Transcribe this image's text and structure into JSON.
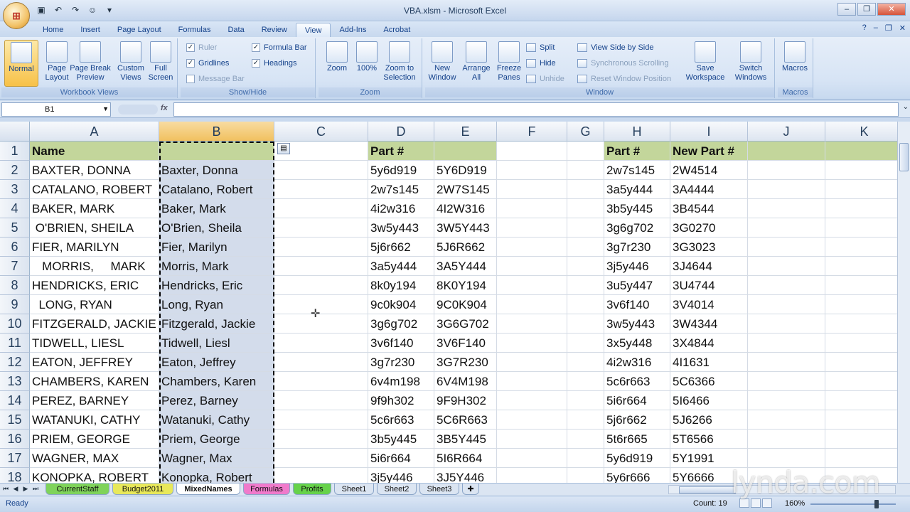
{
  "window": {
    "title": "VBA.xlsm - Microsoft Excel"
  },
  "office_button": {
    "icon": "office-logo-icon"
  },
  "ribbon_tabs": [
    "Home",
    "Insert",
    "Page Layout",
    "Formulas",
    "Data",
    "Review",
    "View",
    "Add-Ins",
    "Acrobat"
  ],
  "active_tab": "View",
  "ribbon": {
    "workbook_views": {
      "label": "Workbook Views",
      "normal": "Normal",
      "page_layout": "Page\nLayout",
      "page_break": "Page Break\nPreview",
      "custom_views": "Custom\nViews",
      "full_screen": "Full\nScreen"
    },
    "show_hide": {
      "label": "Show/Hide",
      "ruler": "Ruler",
      "gridlines": "Gridlines",
      "message_bar": "Message Bar",
      "formula_bar": "Formula Bar",
      "headings": "Headings"
    },
    "zoom": {
      "label": "Zoom",
      "zoom": "Zoom",
      "hundred": "100%",
      "zoom_selection": "Zoom to\nSelection"
    },
    "window": {
      "label": "Window",
      "new_window": "New\nWindow",
      "arrange_all": "Arrange\nAll",
      "freeze_panes": "Freeze\nPanes",
      "split": "Split",
      "hide": "Hide",
      "unhide": "Unhide",
      "side_by_side": "View Side by Side",
      "sync_scroll": "Synchronous Scrolling",
      "reset_pos": "Reset Window Position",
      "save_workspace": "Save\nWorkspace",
      "switch_windows": "Switch\nWindows"
    },
    "macros": {
      "label": "Macros",
      "macros": "Macros"
    }
  },
  "formula_bar": {
    "name_box": "B1",
    "fx": "fx",
    "content": ""
  },
  "columns": [
    "A",
    "B",
    "C",
    "D",
    "E",
    "F",
    "G",
    "H",
    "I",
    "J",
    "K"
  ],
  "rows": [
    {
      "n": "1",
      "A": "Name",
      "B": "",
      "D": "Part #",
      "E": "",
      "H": "Part #",
      "I": "New Part #"
    },
    {
      "n": "2",
      "A": "BAXTER, DONNA",
      "B": "Baxter, Donna",
      "D": "5y6d919",
      "E": "5Y6D919",
      "H": "2w7s145",
      "I": "2W4514"
    },
    {
      "n": "3",
      "A": "CATALANO, ROBERT",
      "B": "Catalano, Robert",
      "D": "2w7s145",
      "E": "2W7S145",
      "H": "3a5y444",
      "I": "3A4444"
    },
    {
      "n": "4",
      "A": "BAKER, MARK",
      "B": "Baker, Mark",
      "D": "4i2w316",
      "E": "4I2W316",
      "H": "3b5y445",
      "I": "3B4544"
    },
    {
      "n": "5",
      "A": " O'BRIEN, SHEILA",
      "B": "O'Brien, Sheila",
      "D": "3w5y443",
      "E": "3W5Y443",
      "H": "3g6g702",
      "I": "3G0270"
    },
    {
      "n": "6",
      "A": "FIER, MARILYN",
      "B": "Fier, Marilyn",
      "D": "5j6r662",
      "E": "5J6R662",
      "H": "3g7r230",
      "I": "3G3023"
    },
    {
      "n": "7",
      "A": "   MORRIS,     MARK",
      "B": "Morris, Mark",
      "D": "3a5y444",
      "E": "3A5Y444",
      "H": "3j5y446",
      "I": "3J4644"
    },
    {
      "n": "8",
      "A": "HENDRICKS, ERIC",
      "B": "Hendricks, Eric",
      "D": "8k0y194",
      "E": "8K0Y194",
      "H": "3u5y447",
      "I": "3U4744"
    },
    {
      "n": "9",
      "A": "  LONG, RYAN",
      "B": "Long, Ryan",
      "D": "9c0k904",
      "E": "9C0K904",
      "H": "3v6f140",
      "I": "3V4014"
    },
    {
      "n": "10",
      "A": "FITZGERALD, JACKIE",
      "B": "Fitzgerald, Jackie",
      "D": "3g6g702",
      "E": "3G6G702",
      "H": "3w5y443",
      "I": "3W4344"
    },
    {
      "n": "11",
      "A": "TIDWELL, LIESL",
      "B": "Tidwell, Liesl",
      "D": "3v6f140",
      "E": "3V6F140",
      "H": "3x5y448",
      "I": "3X4844"
    },
    {
      "n": "12",
      "A": "EATON, JEFFREY",
      "B": "Eaton, Jeffrey",
      "D": "3g7r230",
      "E": "3G7R230",
      "H": "4i2w316",
      "I": "4I1631"
    },
    {
      "n": "13",
      "A": "CHAMBERS, KAREN",
      "B": "Chambers, Karen",
      "D": "6v4m198",
      "E": "6V4M198",
      "H": "5c6r663",
      "I": "5C6366"
    },
    {
      "n": "14",
      "A": "PEREZ, BARNEY",
      "B": "Perez, Barney",
      "D": "9f9h302",
      "E": "9F9H302",
      "H": "5i6r664",
      "I": "5I6466"
    },
    {
      "n": "15",
      "A": "WATANUKI, CATHY",
      "B": "Watanuki, Cathy",
      "D": "5c6r663",
      "E": "5C6R663",
      "H": "5j6r662",
      "I": "5J6266"
    },
    {
      "n": "16",
      "A": "PRIEM, GEORGE",
      "B": "Priem, George",
      "D": "3b5y445",
      "E": "3B5Y445",
      "H": "5t6r665",
      "I": "5T6566"
    },
    {
      "n": "17",
      "A": "WAGNER, MAX",
      "B": "Wagner, Max",
      "D": "5i6r664",
      "E": "5I6R664",
      "H": "5y6d919",
      "I": "5Y1991"
    },
    {
      "n": "18",
      "A": "KONOPKA, ROBERT",
      "B": "Konopka, Robert",
      "D": "3j5y446",
      "E": "3J5Y446",
      "H": "5y6r666",
      "I": "5Y6666"
    }
  ],
  "sheet_tabs": [
    {
      "name": "CurrentStaff",
      "color": "#7fd35a"
    },
    {
      "name": "Budget2011",
      "color": "#e8e85a"
    },
    {
      "name": "MixedNames",
      "color": "#ffffff"
    },
    {
      "name": "Formulas",
      "color": "#f07acb"
    },
    {
      "name": "Profits",
      "color": "#66d24a"
    },
    {
      "name": "Sheet1",
      "color": "#dbe5f2"
    },
    {
      "name": "Sheet2",
      "color": "#dbe5f2"
    },
    {
      "name": "Sheet3",
      "color": "#dbe5f2"
    }
  ],
  "active_sheet": "MixedNames",
  "status": {
    "ready": "Ready",
    "count": "Count: 19",
    "zoom": "160%"
  },
  "watermark": "lynda.com",
  "colors": {
    "header_fill": "#c3d69b",
    "selected_col": "#f1c15f",
    "ribbon": "#d7e4f5"
  }
}
